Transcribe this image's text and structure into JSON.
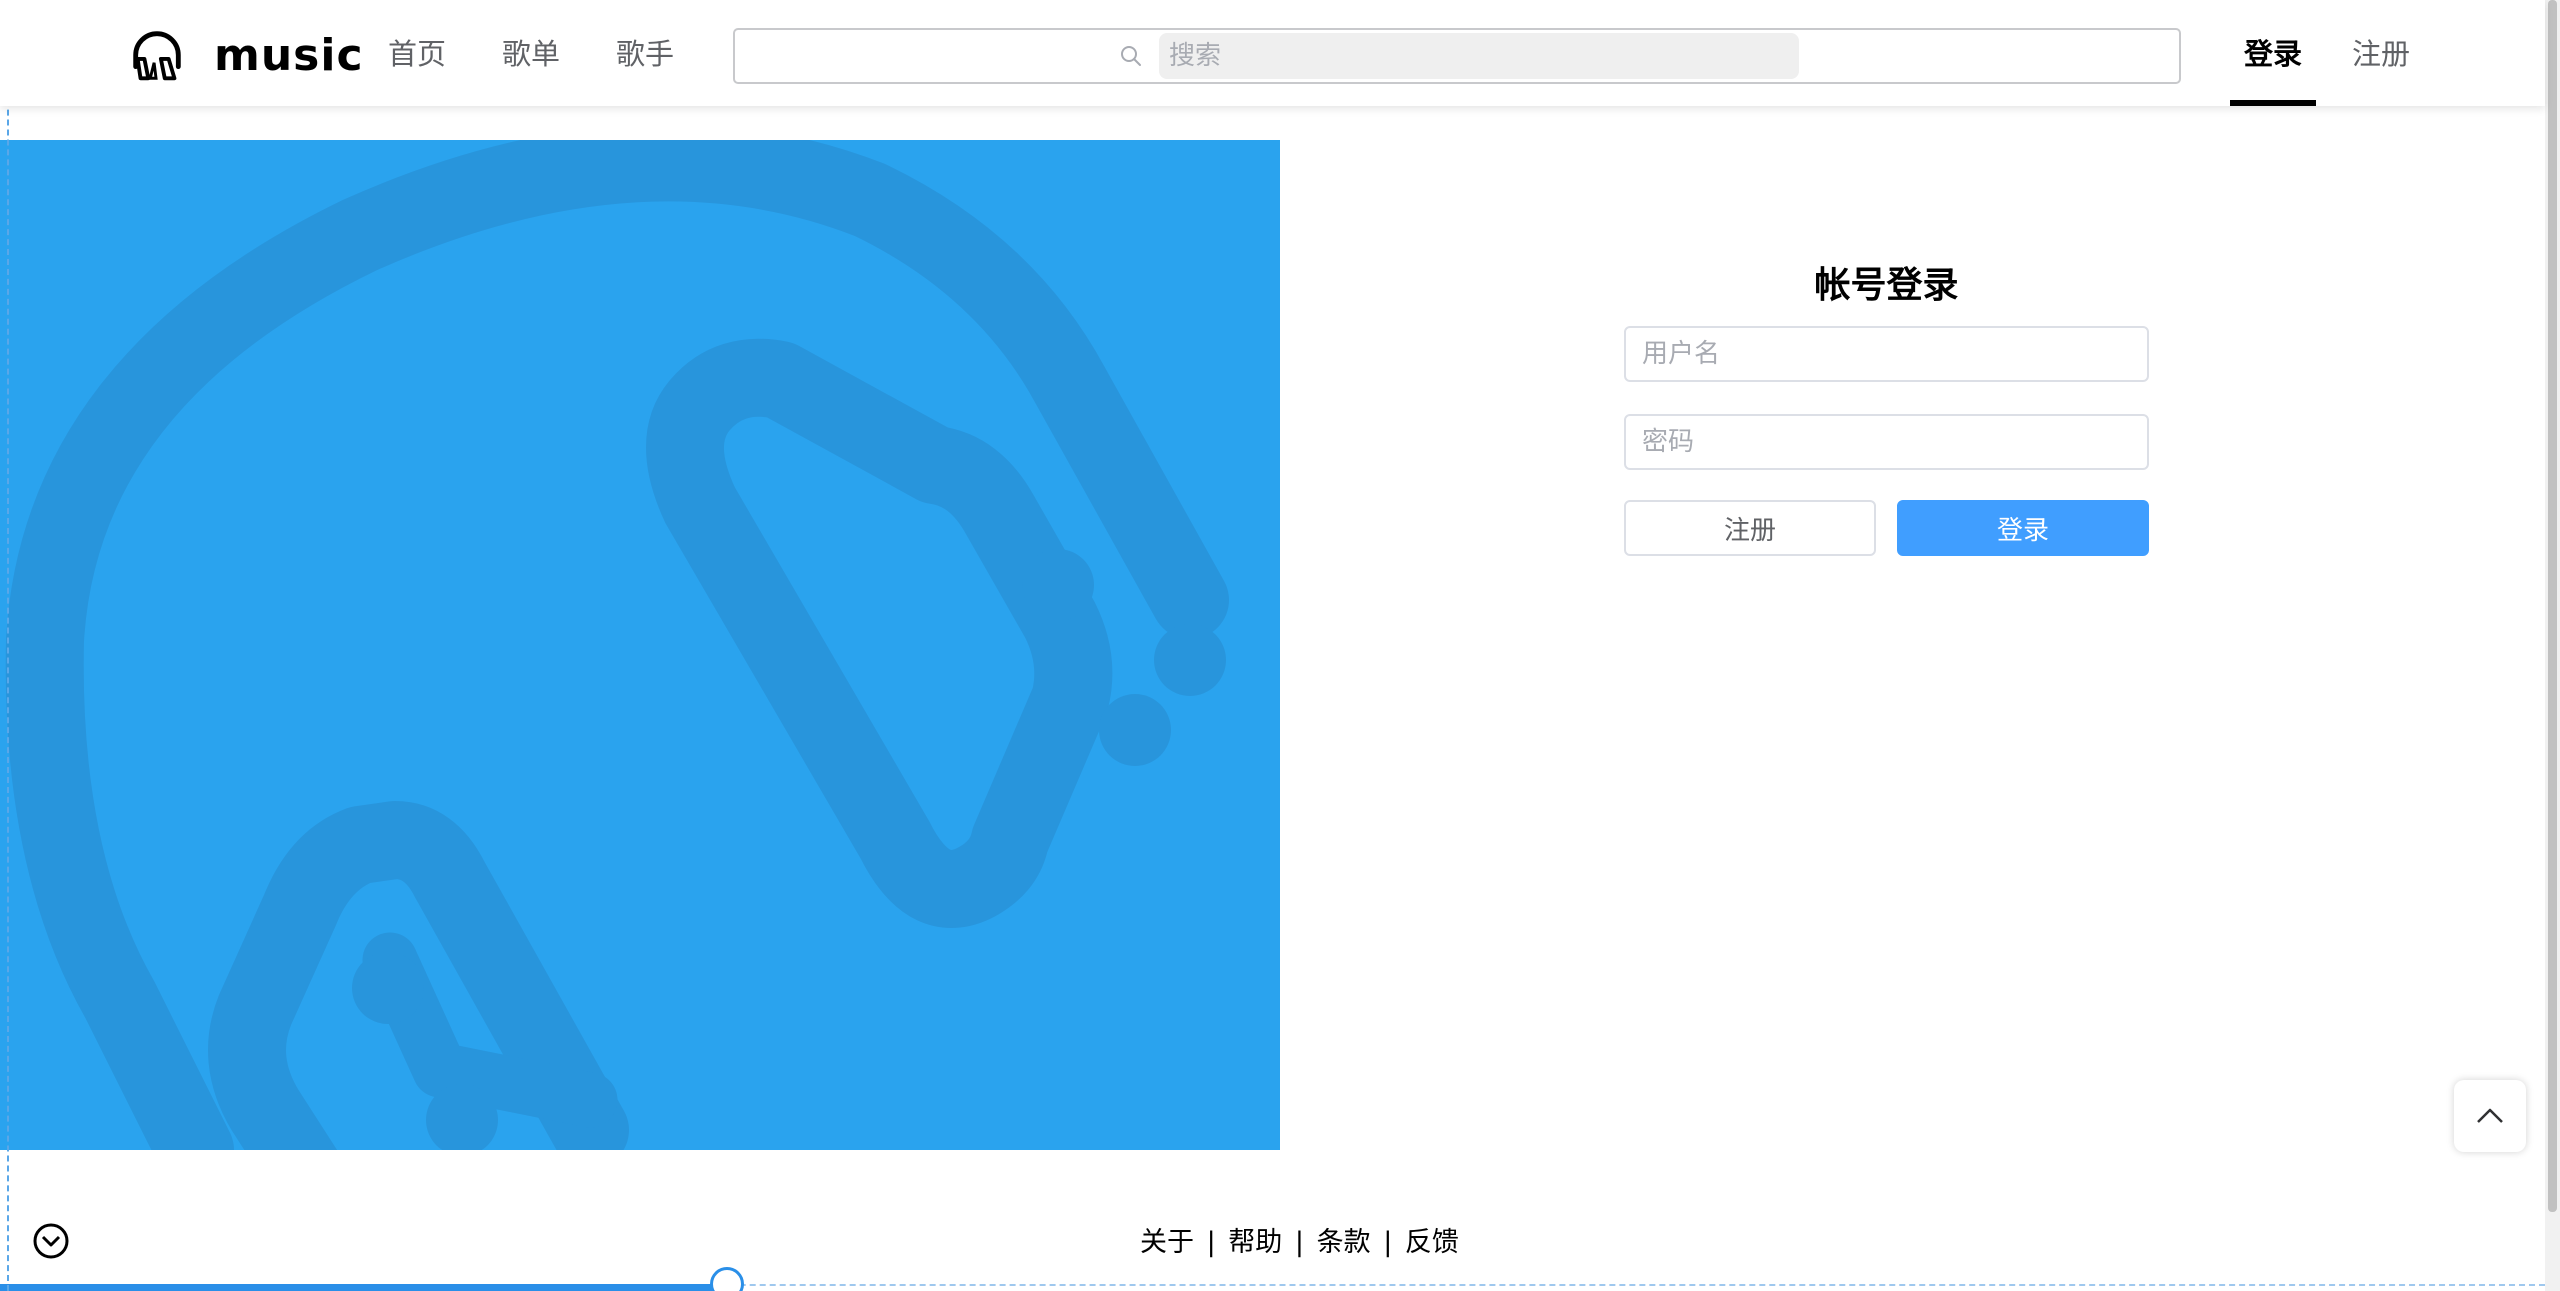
{
  "header": {
    "logo_text": "music",
    "nav": [
      "首页",
      "歌单",
      "歌手"
    ],
    "search_placeholder": "搜索",
    "login_label": "登录",
    "register_label": "注册"
  },
  "login_form": {
    "title": "帐号登录",
    "username_placeholder": "用户名",
    "password_placeholder": "密码",
    "register_button": "注册",
    "login_button": "登录"
  },
  "footer": {
    "links": [
      "关于",
      "帮助",
      "条款",
      "反馈"
    ],
    "separator": "|"
  },
  "player": {
    "progress_fraction": 0.286
  },
  "colors": {
    "banner": "#2aa3ee",
    "banner_logo": "#2895dc",
    "primary_button": "#409eff",
    "progress": "#2a8fe8"
  },
  "icons": {
    "logo": "headphones-icon",
    "search": "search-icon",
    "back_to_top": "chevron-up-icon",
    "collapse": "chevron-down-circle-icon"
  }
}
